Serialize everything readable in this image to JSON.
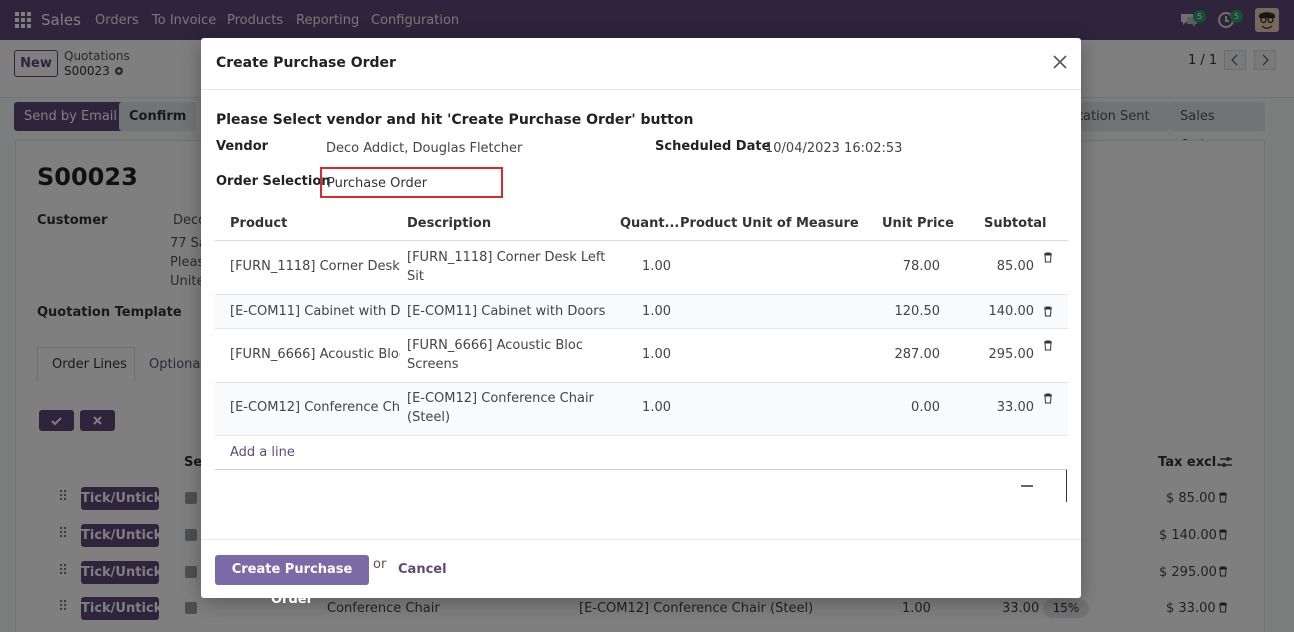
{
  "navbar": {
    "app_name": "Sales",
    "menu": [
      "Orders",
      "To Invoice",
      "Products",
      "Reporting",
      "Configuration"
    ],
    "chat_badge": "5",
    "activity_badge": "5"
  },
  "control_panel": {
    "new_label": "New",
    "breadcrumb_parent": "Quotations",
    "record_name": "S00023",
    "pager": "1 / 1"
  },
  "actions": {
    "send_email": "Send by Email",
    "confirm": "Confirm",
    "status_steps": [
      "otation Sent",
      "Sales Order"
    ]
  },
  "form": {
    "title": "S00023",
    "customer_label": "Customer",
    "customer_lines": [
      "Deco",
      "77 Sa",
      "Pleas",
      "Unite"
    ],
    "template_label": "Quotation Template",
    "tabs": [
      "Order Lines",
      "Optional"
    ],
    "col_sel": "Sel",
    "col_tax_excl": "Tax excl.",
    "lines": [
      {
        "button": "Tick/Untick",
        "product": "",
        "description": "",
        "qty": "",
        "price": "",
        "tax": "",
        "total": "$ 85.00"
      },
      {
        "button": "Tick/Untick",
        "product": "",
        "description": "",
        "qty": "",
        "price": "",
        "tax": "",
        "total": "$ 140.00"
      },
      {
        "button": "Tick/Untick",
        "product": "",
        "description": "",
        "qty": "",
        "price": "",
        "tax": "",
        "total": "$ 295.00"
      },
      {
        "button": "Tick/Untick",
        "product": "Conference Chair",
        "description": "[E-COM12] Conference Chair (Steel)",
        "qty": "1.00",
        "price": "33.00",
        "tax": "15%",
        "total": "$ 33.00"
      }
    ]
  },
  "dialog": {
    "title": "Create Purchase Order",
    "instruction": "Please Select vendor and hit 'Create Purchase Order' button",
    "vendor_label": "Vendor",
    "vendor_value": "Deco Addict, Douglas Fletcher",
    "date_label": "Scheduled Date",
    "date_value": "10/04/2023 16:02:53",
    "order_sel_label": "Order Selection",
    "order_sel_value": "Purchase Order",
    "columns": [
      "Product",
      "Description",
      "Quant...",
      "Product Unit of Measure",
      "Unit Price",
      "Subtotal"
    ],
    "rows": [
      {
        "product": "[FURN_1118] Corner Desk ...",
        "desc1": "[FURN_1118] Corner Desk Left",
        "desc2": "Sit",
        "qty": "1.00",
        "price": "78.00",
        "subtotal": "85.00"
      },
      {
        "product": "[E-COM11] Cabinet with D...",
        "desc1": "[E-COM11] Cabinet with Doors",
        "desc2": "",
        "qty": "1.00",
        "price": "120.50",
        "subtotal": "140.00"
      },
      {
        "product": "[FURN_6666] Acoustic Bloc...",
        "desc1": "[FURN_6666] Acoustic Bloc",
        "desc2": "Screens",
        "qty": "1.00",
        "price": "287.00",
        "subtotal": "295.00"
      },
      {
        "product": "[E-COM12] Conference Cha...",
        "desc1": "[E-COM12] Conference Chair",
        "desc2": "(Steel)",
        "qty": "1.00",
        "price": "0.00",
        "subtotal": "33.00"
      }
    ],
    "add_line": "Add a line",
    "create_button": "Create Purchase Order",
    "or_text": "or",
    "cancel": "Cancel"
  }
}
